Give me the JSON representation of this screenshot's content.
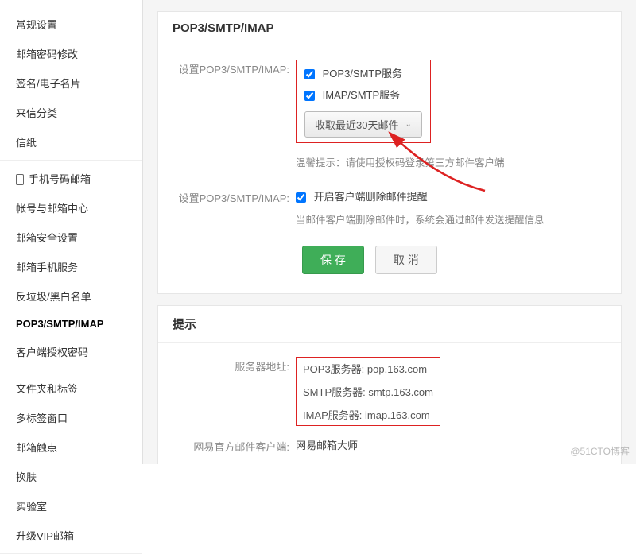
{
  "sidebar": {
    "group1": [
      {
        "label": "常规设置"
      },
      {
        "label": "邮箱密码修改"
      },
      {
        "label": "签名/电子名片"
      },
      {
        "label": "来信分类"
      },
      {
        "label": "信纸"
      }
    ],
    "group2": [
      {
        "label": "手机号码邮箱",
        "icon": true
      },
      {
        "label": "帐号与邮箱中心"
      },
      {
        "label": "邮箱安全设置"
      },
      {
        "label": "邮箱手机服务"
      },
      {
        "label": "反垃圾/黑白名单"
      },
      {
        "label": "POP3/SMTP/IMAP",
        "active": true
      },
      {
        "label": "客户端授权密码"
      }
    ],
    "group3": [
      {
        "label": "文件夹和标签"
      },
      {
        "label": "多标签窗口"
      },
      {
        "label": "邮箱触点"
      },
      {
        "label": "换肤"
      },
      {
        "label": "实验室"
      },
      {
        "label": "升级VIP邮箱"
      }
    ]
  },
  "main": {
    "panel1_title": "POP3/SMTP/IMAP",
    "row1_label": "设置POP3/SMTP/IMAP:",
    "chk_pop3": "POP3/SMTP服务",
    "chk_imap": "IMAP/SMTP服务",
    "dropdown": "收取最近30天邮件",
    "hint1": "温馨提示：请使用授权码登录第三方邮件客户端",
    "row2_label": "设置POP3/SMTP/IMAP:",
    "chk_notify": "开启客户端删除邮件提醒",
    "hint2": "当邮件客户端删除邮件时，系统会通过邮件发送提醒信息",
    "btn_save": "保 存",
    "btn_cancel": "取 消",
    "panel2_title": "提示",
    "server_label": "服务器地址:",
    "server_pop3": "POP3服务器: pop.163.com",
    "server_smtp": "SMTP服务器: smtp.163.com",
    "server_imap": "IMAP服务器: imap.163.com",
    "client_label": "网易官方邮件客户端:",
    "client_value": "网易邮箱大师"
  },
  "watermark": "@51CTO博客"
}
